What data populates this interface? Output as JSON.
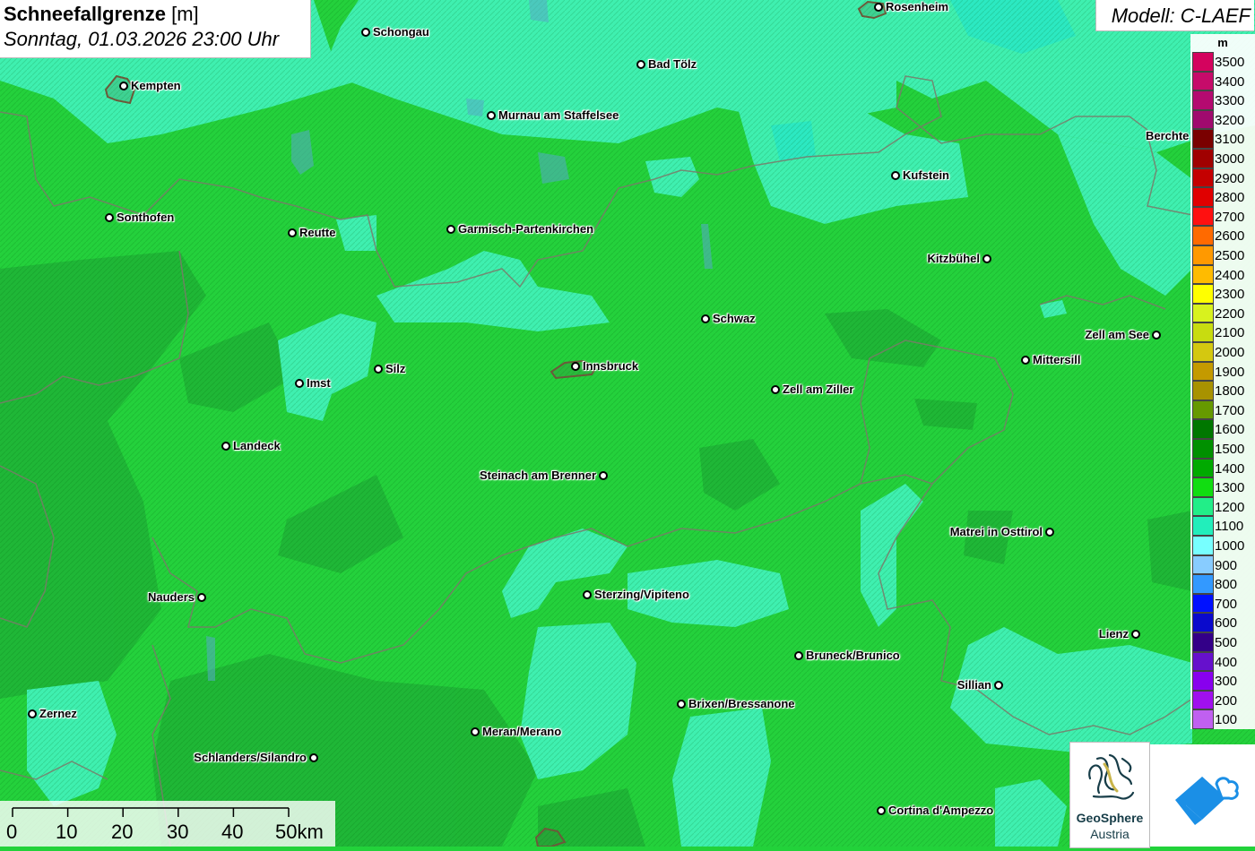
{
  "title": {
    "main": "Schneefallgrenze",
    "unit": "[m]",
    "datetime": "Sonntag, 01.03.2026 23:00 Uhr"
  },
  "model": "Modell: C-LAEF",
  "legend": {
    "unit": "m",
    "entries": [
      {
        "label": "3500",
        "color": "#d4035e"
      },
      {
        "label": "3400",
        "color": "#c60b6a"
      },
      {
        "label": "3300",
        "color": "#b40a70"
      },
      {
        "label": "3200",
        "color": "#a00a6e"
      },
      {
        "label": "3100",
        "color": "#7a0000"
      },
      {
        "label": "3000",
        "color": "#a00000"
      },
      {
        "label": "2900",
        "color": "#c40000"
      },
      {
        "label": "2800",
        "color": "#e00000"
      },
      {
        "label": "2700",
        "color": "#ff1010"
      },
      {
        "label": "2600",
        "color": "#ff6a00"
      },
      {
        "label": "2500",
        "color": "#ff9900"
      },
      {
        "label": "2400",
        "color": "#ffbb00"
      },
      {
        "label": "2300",
        "color": "#ffff00"
      },
      {
        "label": "2200",
        "color": "#d8f21e"
      },
      {
        "label": "2100",
        "color": "#c8dc10"
      },
      {
        "label": "2000",
        "color": "#d4c810"
      },
      {
        "label": "1900",
        "color": "#c49a00"
      },
      {
        "label": "1800",
        "color": "#a89200"
      },
      {
        "label": "1700",
        "color": "#669900"
      },
      {
        "label": "1600",
        "color": "#007700"
      },
      {
        "label": "1500",
        "color": "#009000"
      },
      {
        "label": "1400",
        "color": "#00aa00"
      },
      {
        "label": "1300",
        "color": "#11dd11"
      },
      {
        "label": "1200",
        "color": "#22ee88"
      },
      {
        "label": "1100",
        "color": "#22eebb"
      },
      {
        "label": "1000",
        "color": "#77ffff"
      },
      {
        "label": "900",
        "color": "#88ccff"
      },
      {
        "label": "800",
        "color": "#3399ff"
      },
      {
        "label": "700",
        "color": "#0011ff"
      },
      {
        "label": "600",
        "color": "#0a0acc"
      },
      {
        "label": "500",
        "color": "#330088"
      },
      {
        "label": "400",
        "color": "#6611cc"
      },
      {
        "label": "300",
        "color": "#8800ee"
      },
      {
        "label": "200",
        "color": "#a010ee"
      },
      {
        "label": "100",
        "color": "#c060f0"
      }
    ]
  },
  "cities": [
    {
      "name": "Rosenheim"
    },
    {
      "name": "Schongau"
    },
    {
      "name": "Bad Tölz"
    },
    {
      "name": "Kempten"
    },
    {
      "name": "Murnau am Staffelsee"
    },
    {
      "name": "Berchte"
    },
    {
      "name": "Kufstein"
    },
    {
      "name": "Sonthofen"
    },
    {
      "name": "Reutte"
    },
    {
      "name": "Garmisch-Partenkirchen"
    },
    {
      "name": "Kitzbühel"
    },
    {
      "name": "Schwaz"
    },
    {
      "name": "Zell am See"
    },
    {
      "name": "Mittersill"
    },
    {
      "name": "Imst"
    },
    {
      "name": "Silz"
    },
    {
      "name": "Innsbruck"
    },
    {
      "name": "Zell am Ziller"
    },
    {
      "name": "Landeck"
    },
    {
      "name": "Steinach am Brenner"
    },
    {
      "name": "Matrei in Osttirol"
    },
    {
      "name": "Nauders"
    },
    {
      "name": "Sterzing/Vipiteno"
    },
    {
      "name": "Lienz"
    },
    {
      "name": "Bruneck/Brunico"
    },
    {
      "name": "Sillian"
    },
    {
      "name": "Brixen/Bressanone"
    },
    {
      "name": "Zernez"
    },
    {
      "name": "Meran/Merano"
    },
    {
      "name": "Schlanders/Silandro"
    },
    {
      "name": "Cortina d'Ampezzo"
    }
  ],
  "scale": {
    "ticks": [
      "0",
      "10",
      "20",
      "30",
      "40",
      "50km"
    ]
  },
  "logos": {
    "geosphere_line1": "GeoSphere",
    "geosphere_line2": "Austria"
  }
}
